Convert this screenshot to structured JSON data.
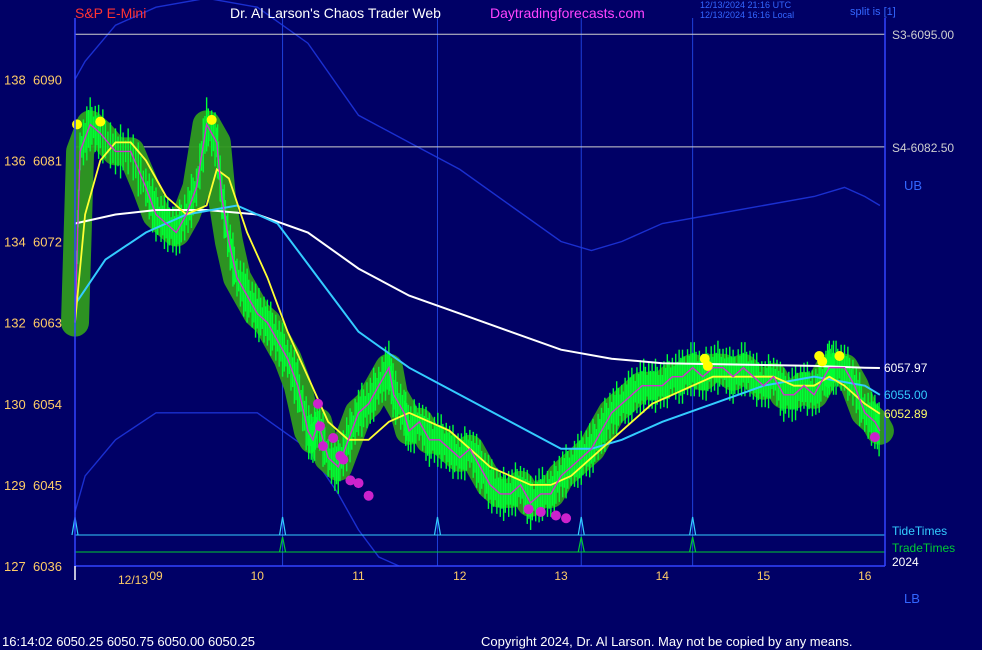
{
  "header": {
    "symbol": "S&P E-Mini",
    "title": "Dr. Al Larson's Chaos Trader Web",
    "site": "Daytradingforecasts.com",
    "time_utc": "12/13/2024 21:16 UTC",
    "time_local": "12/13/2024 16:16 Local",
    "split_label": "split is [1]",
    "ub": "UB",
    "lb": "LB"
  },
  "footer": {
    "quote": "16:14:02  6050.25 6050.75 6050.00 6050.25",
    "copyright": "Copyright 2024, Dr. Al Larson. May not be copied by any means."
  },
  "chart_data": {
    "type": "line",
    "x_label_date": "12/13",
    "x_year": "2024",
    "x_ticks": [
      "09",
      "10",
      "11",
      "12",
      "13",
      "14",
      "15",
      "16"
    ],
    "y_ticks_left": [
      {
        "a": "138",
        "b": "6090",
        "v": 6090
      },
      {
        "a": "136",
        "b": "6081",
        "v": 6081
      },
      {
        "a": "134",
        "b": "6072",
        "v": 6072
      },
      {
        "a": "132",
        "b": "6063",
        "v": 6063
      },
      {
        "a": "130",
        "b": "6054",
        "v": 6054
      },
      {
        "a": "129",
        "b": "6045",
        "v": 6045
      },
      {
        "a": "127",
        "b": "6036",
        "v": 6036
      }
    ],
    "ylim": [
      6036,
      6096.8
    ],
    "xlim": [
      8.2,
      16.2
    ],
    "levels": [
      {
        "label": "S3-6095.00",
        "value": 6095.0
      },
      {
        "label": "S4-6082.50",
        "value": 6082.5
      }
    ],
    "right_values": [
      {
        "label": "6057.97",
        "value": 6057.97,
        "color": "#ffffff"
      },
      {
        "label": "6055.00",
        "value": 6055.0,
        "color": "#33ccff"
      },
      {
        "label": "6052.89",
        "value": 6052.89,
        "color": "#ffff66"
      }
    ],
    "tide_label": "TideTimes",
    "trade_label": "TradeTimes",
    "tide_times": [
      8.2,
      10.25,
      11.78,
      13.2,
      14.3
    ],
    "trade_times": [
      10.25,
      13.2,
      14.3
    ],
    "vertical_grid": [
      10.25,
      11.78,
      13.2,
      14.3
    ],
    "price": {
      "x": [
        8.2,
        8.25,
        8.35,
        8.45,
        8.6,
        8.75,
        8.9,
        9.0,
        9.1,
        9.2,
        9.3,
        9.4,
        9.5,
        9.6,
        9.65,
        9.72,
        9.8,
        9.9,
        10.0,
        10.1,
        10.2,
        10.3,
        10.4,
        10.5,
        10.55,
        10.6,
        10.7,
        10.8,
        10.9,
        11.0,
        11.1,
        11.2,
        11.3,
        11.35,
        11.45,
        11.5,
        11.6,
        11.7,
        11.8,
        11.9,
        12.0,
        12.1,
        12.2,
        12.3,
        12.4,
        12.5,
        12.6,
        12.7,
        12.8,
        12.9,
        13.0,
        13.1,
        13.2,
        13.3,
        13.4,
        13.5,
        13.6,
        13.7,
        13.8,
        13.9,
        14.0,
        14.1,
        14.2,
        14.3,
        14.4,
        14.5,
        14.6,
        14.7,
        14.8,
        14.9,
        15.0,
        15.1,
        15.2,
        15.3,
        15.4,
        15.5,
        15.6,
        15.65,
        15.7,
        15.8,
        15.9,
        16.0,
        16.1,
        16.15
      ],
      "y": [
        6063,
        6082,
        6085,
        6084,
        6082,
        6082,
        6078,
        6075,
        6074,
        6073,
        6075,
        6078,
        6085,
        6083,
        6077,
        6072,
        6068,
        6066,
        6064,
        6063,
        6061,
        6059,
        6056,
        6051,
        6050,
        6052,
        6048,
        6047,
        6050,
        6053,
        6054,
        6056,
        6058,
        6055,
        6053,
        6051,
        6052,
        6050,
        6050,
        6049,
        6048,
        6049,
        6047,
        6045,
        6044,
        6044,
        6045,
        6043,
        6044,
        6044,
        6046,
        6047,
        6048,
        6049,
        6051,
        6053,
        6054,
        6055,
        6056,
        6056,
        6056,
        6057,
        6057,
        6058,
        6057,
        6058,
        6058,
        6057,
        6058,
        6057,
        6056,
        6057,
        6055,
        6055,
        6056,
        6055,
        6057,
        6058,
        6058,
        6058,
        6056,
        6053,
        6052,
        6051
      ]
    },
    "ema_fast": {
      "x": [
        8.2,
        8.3,
        8.45,
        8.6,
        8.75,
        8.9,
        9.1,
        9.3,
        9.5,
        9.6,
        9.72,
        9.9,
        10.1,
        10.3,
        10.5,
        10.7,
        10.9,
        11.1,
        11.3,
        11.5,
        11.7,
        11.9,
        12.1,
        12.3,
        12.5,
        12.7,
        12.9,
        13.1,
        13.3,
        13.5,
        13.7,
        13.9,
        14.1,
        14.3,
        14.5,
        14.7,
        14.9,
        15.1,
        15.3,
        15.5,
        15.65,
        15.8,
        16.0,
        16.15
      ],
      "y": [
        6063,
        6075,
        6081,
        6083,
        6083,
        6081,
        6077,
        6075,
        6076,
        6080,
        6079,
        6073,
        6068,
        6062,
        6057,
        6052,
        6050,
        6050,
        6052,
        6053,
        6052,
        6051,
        6049,
        6047,
        6046,
        6045,
        6045,
        6046,
        6048,
        6050,
        6052,
        6054,
        6055,
        6056,
        6057,
        6057,
        6057,
        6057,
        6056,
        6056,
        6057,
        6056,
        6054,
        6052.9
      ]
    },
    "avg_cyan": {
      "x": [
        8.2,
        8.5,
        8.9,
        9.3,
        9.8,
        10.2,
        10.6,
        11.0,
        11.5,
        12.0,
        12.5,
        13.0,
        13.3,
        13.6,
        14.0,
        14.5,
        15.0,
        15.5,
        16.0,
        16.15
      ],
      "y": [
        6065,
        6070,
        6073,
        6075,
        6076,
        6074,
        6068,
        6062,
        6058,
        6055,
        6052,
        6049,
        6049,
        6050,
        6052,
        6054,
        6056,
        6057,
        6056,
        6055
      ]
    },
    "avg_white": {
      "x": [
        8.2,
        8.6,
        9.0,
        9.5,
        10.0,
        10.5,
        11.0,
        11.5,
        12.0,
        12.5,
        13.0,
        13.5,
        14.0,
        14.5,
        15.0,
        15.5,
        16.0,
        16.15
      ],
      "y": [
        6074,
        6075,
        6075.5,
        6075.5,
        6075,
        6073,
        6069,
        6066,
        6064,
        6062,
        6060,
        6059,
        6058.5,
        6058.4,
        6058.3,
        6058.2,
        6058,
        6057.97
      ]
    },
    "upper_band": {
      "x": [
        8.2,
        8.3,
        8.6,
        9.0,
        9.5,
        10.0,
        10.5,
        11.0,
        11.5,
        12.0,
        12.5,
        13.0,
        13.3,
        13.6,
        14.0,
        14.5,
        15.0,
        15.5,
        15.8,
        16.0,
        16.15
      ],
      "y": [
        6090,
        6092,
        6096,
        6098,
        6099,
        6098,
        6094,
        6086,
        6083,
        6080,
        6076,
        6072,
        6071,
        6072,
        6074,
        6075,
        6076,
        6077,
        6078,
        6077,
        6076
      ]
    },
    "lower_band": {
      "x": [
        8.2,
        8.3,
        8.6,
        9.0,
        9.5,
        10.0,
        10.5,
        10.8,
        11.0,
        11.2,
        11.4
      ],
      "y": [
        6042,
        6046,
        6050,
        6053,
        6053,
        6053,
        6049,
        6044,
        6040,
        6037,
        6036
      ]
    },
    "dots_yellow": [
      {
        "x": 8.22,
        "y": 6085
      },
      {
        "x": 8.45,
        "y": 6085.3
      },
      {
        "x": 9.55,
        "y": 6085.5
      },
      {
        "x": 14.42,
        "y": 6059
      },
      {
        "x": 14.45,
        "y": 6058.2
      },
      {
        "x": 15.55,
        "y": 6059.3
      },
      {
        "x": 15.58,
        "y": 6058.7
      },
      {
        "x": 15.75,
        "y": 6059.3
      }
    ],
    "dots_magenta": [
      {
        "x": 10.6,
        "y": 6054
      },
      {
        "x": 10.62,
        "y": 6051.5
      },
      {
        "x": 10.65,
        "y": 6049.3
      },
      {
        "x": 10.75,
        "y": 6050.2
      },
      {
        "x": 10.82,
        "y": 6048.2
      },
      {
        "x": 10.85,
        "y": 6047.8
      },
      {
        "x": 10.92,
        "y": 6045.5
      },
      {
        "x": 11.0,
        "y": 6045.2
      },
      {
        "x": 11.1,
        "y": 6043.8
      },
      {
        "x": 12.68,
        "y": 6042.3
      },
      {
        "x": 12.8,
        "y": 6042
      },
      {
        "x": 12.95,
        "y": 6041.6
      },
      {
        "x": 13.05,
        "y": 6041.3
      },
      {
        "x": 16.1,
        "y": 6050.3
      }
    ]
  }
}
